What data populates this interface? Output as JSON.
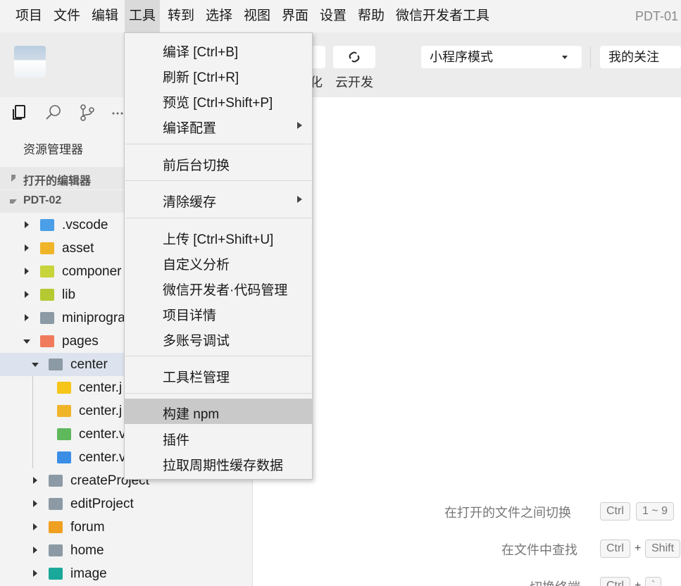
{
  "menubar": {
    "items": [
      "项目",
      "文件",
      "编辑",
      "工具",
      "转到",
      "选择",
      "视图",
      "界面",
      "设置",
      "帮助",
      "微信开发者工具"
    ],
    "app_title": "PDT-01"
  },
  "toolbar": {
    "labels": [
      "化",
      "云开发"
    ],
    "mode_select": "小程序模式",
    "follow_select": "我的关注"
  },
  "sidebar": {
    "explorer_title": "资源管理器",
    "open_editors": "打开的编辑器",
    "project": "PDT-02",
    "tree": [
      {
        "name": ".vscode",
        "icon": "vscode-folder-icon",
        "color": "#4a9fe8"
      },
      {
        "name": "asset",
        "icon": "asset-folder-icon",
        "color": "#f0b429"
      },
      {
        "name": "componer",
        "icon": "component-folder-icon",
        "color": "#c7d43b"
      },
      {
        "name": "lib",
        "icon": "lib-folder-icon",
        "color": "#b5c932"
      },
      {
        "name": "miniprogra",
        "icon": "folder-icon",
        "color": "#8b9aa5"
      },
      {
        "name": "pages",
        "icon": "pages-folder-icon",
        "color": "#f07a5c"
      },
      {
        "name": "center",
        "icon": "folder-open-icon",
        "color": "#8b9aa5"
      },
      {
        "name": "center.j",
        "icon": "js-file-icon",
        "color": "#f5c518"
      },
      {
        "name": "center.j",
        "icon": "json-file-icon",
        "color": "#f0b429"
      },
      {
        "name": "center.v",
        "icon": "wxml-file-icon",
        "color": "#5fb85c"
      },
      {
        "name": "center.v",
        "icon": "wxss-file-icon",
        "color": "#3a8ee6"
      },
      {
        "name": "createProject",
        "icon": "folder-icon",
        "color": "#8b9aa5"
      },
      {
        "name": "editProject",
        "icon": "folder-icon",
        "color": "#8b9aa5"
      },
      {
        "name": "forum",
        "icon": "forum-folder-icon",
        "color": "#f0a020"
      },
      {
        "name": "home",
        "icon": "folder-icon",
        "color": "#8b9aa5"
      },
      {
        "name": "image",
        "icon": "image-folder-icon",
        "color": "#1aa89a"
      }
    ]
  },
  "dropdown": {
    "items": [
      {
        "label": "编译 [Ctrl+B]"
      },
      {
        "label": "刷新 [Ctrl+R]"
      },
      {
        "label": "预览 [Ctrl+Shift+P]"
      },
      {
        "label": "编译配置",
        "submenu": true
      },
      {
        "label": "前后台切换"
      },
      {
        "label": "清除缓存",
        "submenu": true
      },
      {
        "label": "上传 [Ctrl+Shift+U]"
      },
      {
        "label": "自定义分析"
      },
      {
        "label": "微信开发者·代码管理"
      },
      {
        "label": "项目详情"
      },
      {
        "label": "多账号调试"
      },
      {
        "label": "工具栏管理"
      },
      {
        "label": "构建 npm",
        "highlighted": true
      },
      {
        "label": "插件"
      },
      {
        "label": "拉取周期性缓存数据"
      }
    ]
  },
  "hints": {
    "switch_files": "在打开的文件之间切换",
    "switch_keys": [
      "Ctrl",
      "1 ~ 9"
    ],
    "find_in_files": "在文件中查找",
    "find_keys": [
      "Ctrl",
      "Shift"
    ],
    "toggle_terminal": "切换终端",
    "toggle_keys": [
      "Ctrl",
      "`"
    ],
    "plus": "+"
  },
  "colors": {
    "menu_bg": "#f3f3f3",
    "toolbar_bg": "#ececec",
    "highlight": "#c9c9c9",
    "selected_row": "#dde3ee"
  }
}
